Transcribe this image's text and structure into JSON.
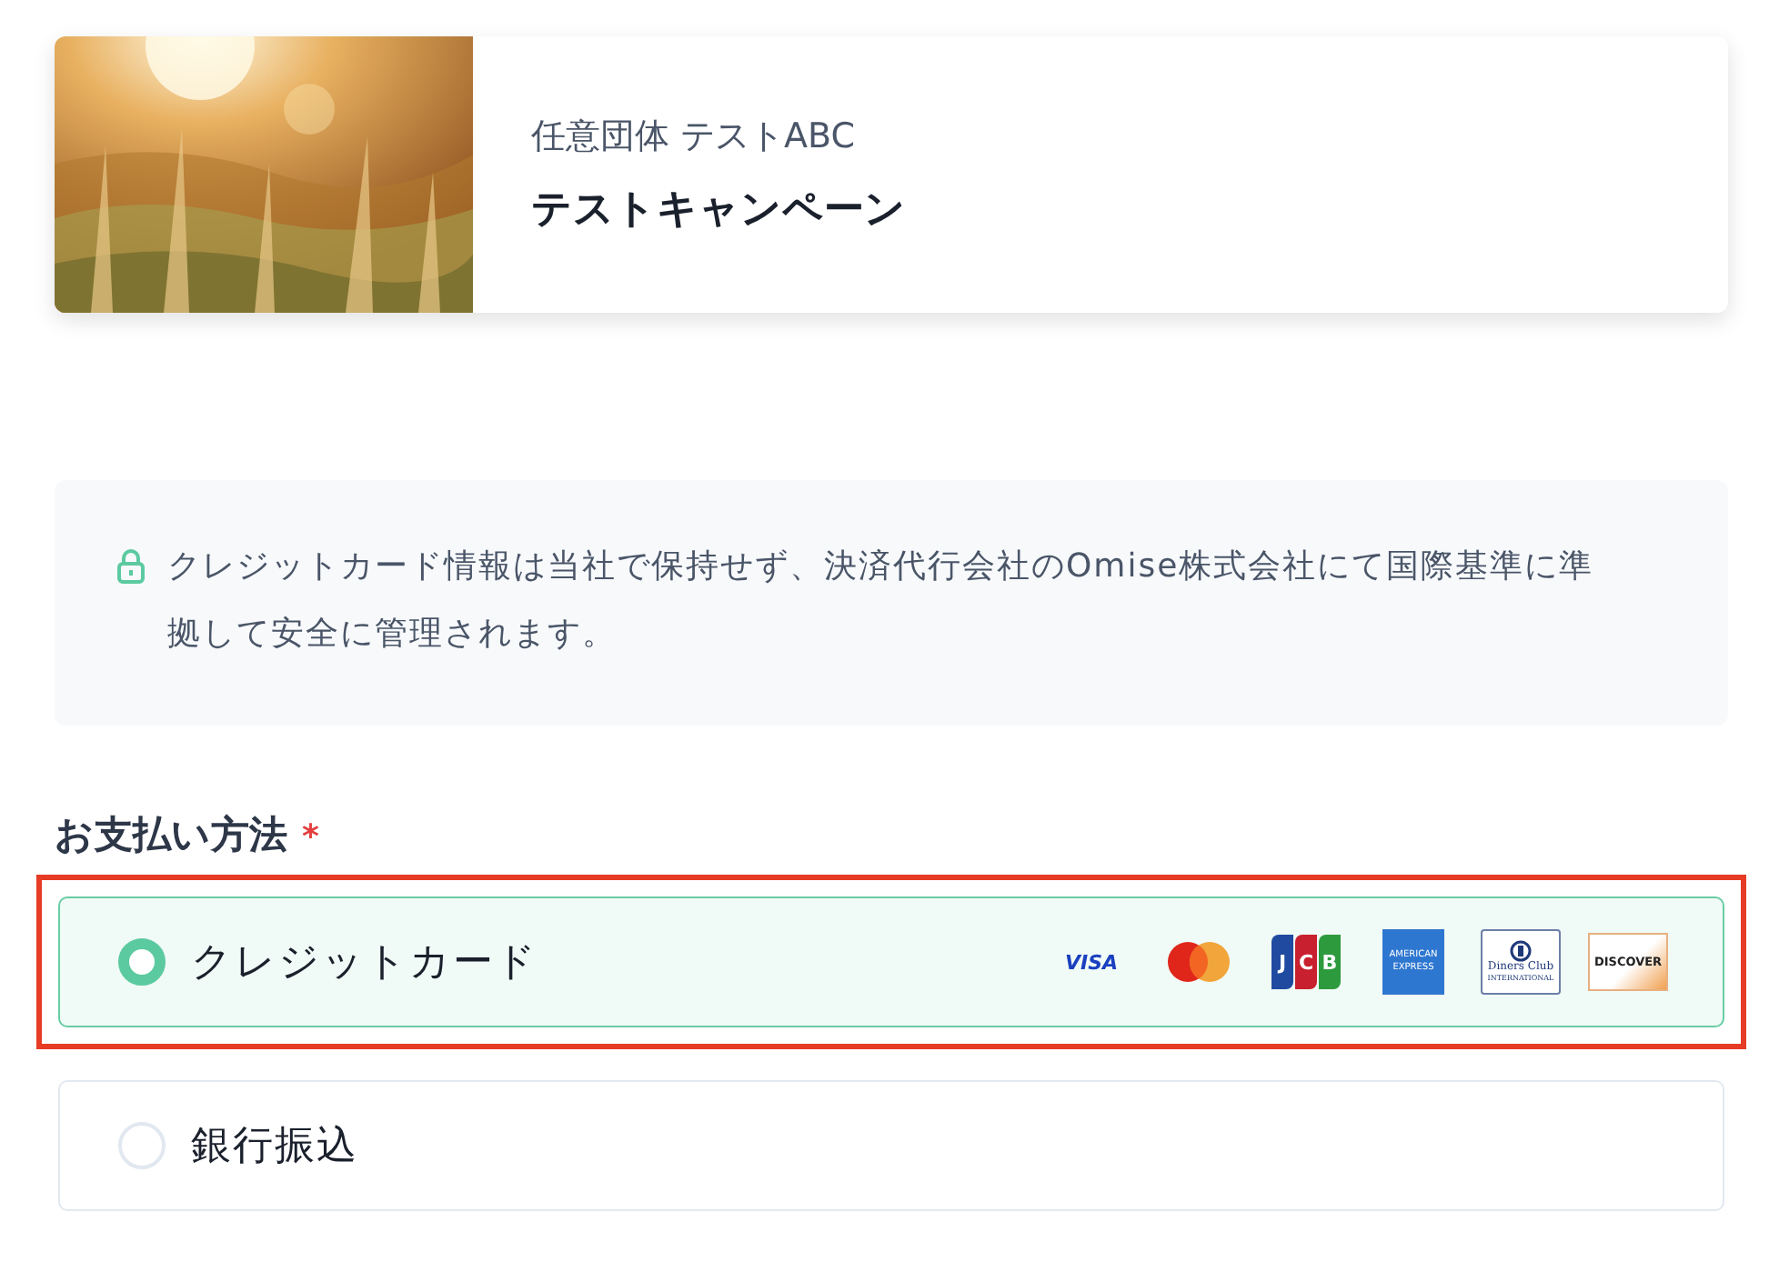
{
  "campaign": {
    "kind": "picture",
    "organization": "任意団体 テストABC",
    "title": "テストキャンペーン"
  },
  "notice": {
    "text": "クレジットカード情報は当社で保持せず、決済代行会社のOmise株式会社にて国際基準に準拠して安全に管理されます。"
  },
  "payment": {
    "label": "お支払い方法",
    "required_mark": "*",
    "methods": [
      {
        "label": "クレジットカード",
        "selected": true,
        "highlighted": true,
        "brands": [
          {
            "kind": "visa",
            "lines": [
              "VISA"
            ]
          },
          {
            "kind": "mastercard"
          },
          {
            "kind": "jcb",
            "lines": [
              "J",
              "C",
              "B"
            ]
          },
          {
            "kind": "amex",
            "lines": [
              "AMERICAN",
              "EXPRESS"
            ]
          },
          {
            "kind": "diners",
            "lines": [
              "Diners Club",
              "INTERNATIONAL"
            ]
          },
          {
            "kind": "discover",
            "lines": [
              "DISCOVER"
            ]
          }
        ]
      },
      {
        "label": "銀行振込",
        "selected": false,
        "highlighted": false
      }
    ]
  }
}
